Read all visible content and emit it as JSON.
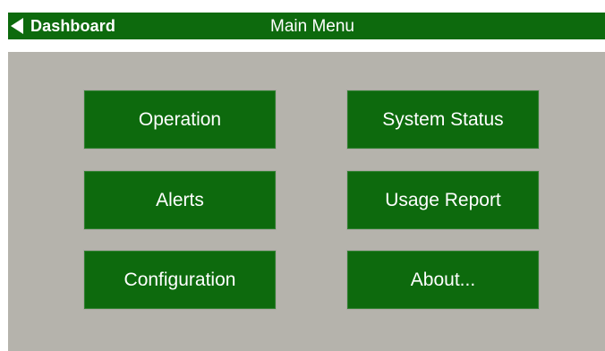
{
  "header": {
    "back_label": "Dashboard",
    "title": "Main Menu"
  },
  "menu": {
    "items": [
      {
        "label": "Operation"
      },
      {
        "label": "System Status"
      },
      {
        "label": "Alerts"
      },
      {
        "label": "Usage Report"
      },
      {
        "label": "Configuration"
      },
      {
        "label": "About..."
      }
    ]
  },
  "colors": {
    "header_bg": "#0d6a0d",
    "button_bg": "#0d6a0d",
    "panel_bg": "#b5b3ac",
    "text": "#ffffff"
  },
  "icons": {
    "back": "left-triangle-arrow"
  }
}
